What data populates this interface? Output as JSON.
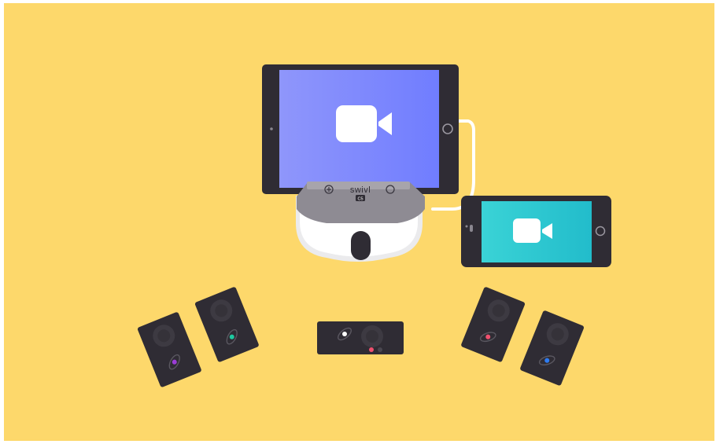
{
  "scene": {
    "background_color": "#fdd86b",
    "base_brand_label": "swivl",
    "base_model_label": "C5",
    "tablet_screen_icon": "video-camera-icon",
    "phone_screen_icon": "video-camera-icon",
    "tablet_screen_color": "#7d88ff",
    "phone_screen_color": "#2ec4cf",
    "marker_accent_colors": [
      "#9b3dd6",
      "#1ec9a0",
      "#ffffff",
      "#f0506e",
      "#2e7cf2"
    ]
  }
}
